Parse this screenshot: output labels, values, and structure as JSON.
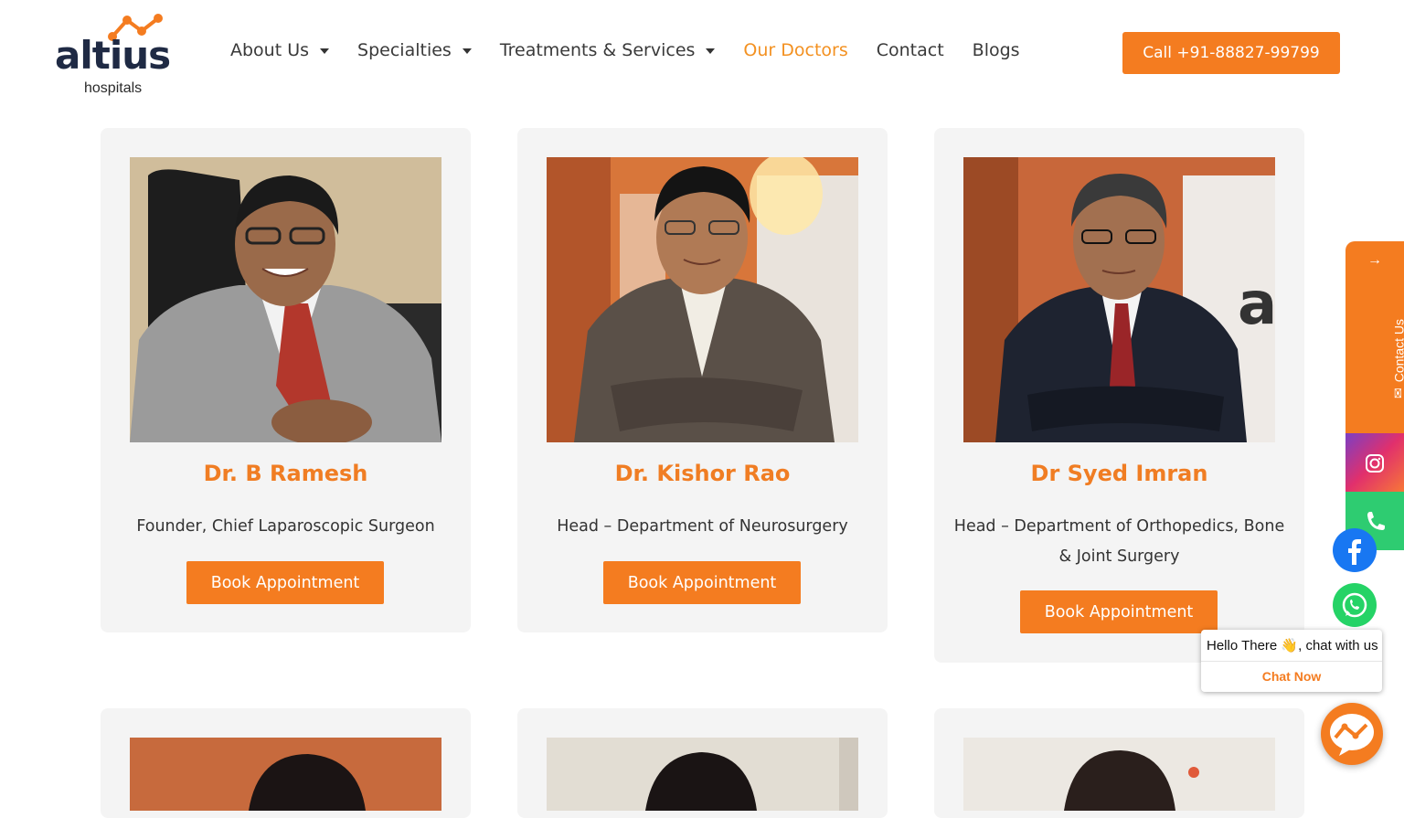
{
  "brand": {
    "name": "altius",
    "sub": "hospitals"
  },
  "nav": {
    "items": [
      {
        "label": "About Us",
        "dropdown": true
      },
      {
        "label": "Specialties",
        "dropdown": true
      },
      {
        "label": "Treatments & Services",
        "dropdown": true
      },
      {
        "label": "Our Doctors",
        "dropdown": false,
        "active": true
      },
      {
        "label": "Contact",
        "dropdown": false
      },
      {
        "label": "Blogs",
        "dropdown": false
      }
    ],
    "call_label": "Call +91-88827-99799"
  },
  "doctors": [
    {
      "name": "Dr. B Ramesh",
      "title": "Founder, Chief Laparoscopic Surgeon",
      "cta": "Book Appointment"
    },
    {
      "name": "Dr. Kishor Rao",
      "title": "Head – Department of Neurosurgery",
      "cta": "Book Appointment"
    },
    {
      "name": "Dr Syed Imran",
      "title": "Head – Department of Orthopedics, Bone & Joint Surgery",
      "cta": "Book Appointment"
    }
  ],
  "side": {
    "contact_label": "Contact Us"
  },
  "chat": {
    "hello": "Hello There 👋, chat with us",
    "now": "Chat Now"
  },
  "colors": {
    "accent": "#f47c20",
    "name": "#f07d23",
    "brand_dark": "#1f2a44"
  }
}
